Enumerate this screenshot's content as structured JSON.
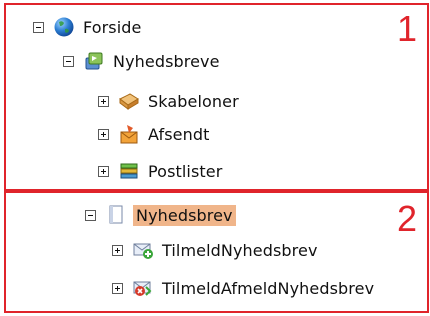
{
  "panels": [
    {
      "number": "1"
    },
    {
      "number": "2"
    }
  ],
  "tree_1": [
    {
      "label": "Forside",
      "state": "expanded",
      "icon": "globe-icon"
    },
    {
      "label": "Nyhedsbreve",
      "state": "expanded",
      "icon": "newsletters-icon"
    },
    {
      "label": "Skabeloner",
      "state": "collapsed",
      "icon": "templates-icon"
    },
    {
      "label": "Afsendt",
      "state": "collapsed",
      "icon": "sent-icon"
    },
    {
      "label": "Postlister",
      "state": "collapsed",
      "icon": "mailing-lists-icon"
    }
  ],
  "tree_2": [
    {
      "label": "Nyhedsbrev",
      "state": "expanded",
      "icon": "document-icon",
      "selected": true
    },
    {
      "label": "TilmeldNyhedsbrev",
      "state": "collapsed",
      "icon": "subscribe-mail-icon"
    },
    {
      "label": "TilmeldAfmeldNyhedsbrev",
      "state": "collapsed",
      "icon": "unsubscribe-mail-icon"
    }
  ],
  "colors": {
    "accent": "#e0242b",
    "selection": "#f0b58a"
  }
}
